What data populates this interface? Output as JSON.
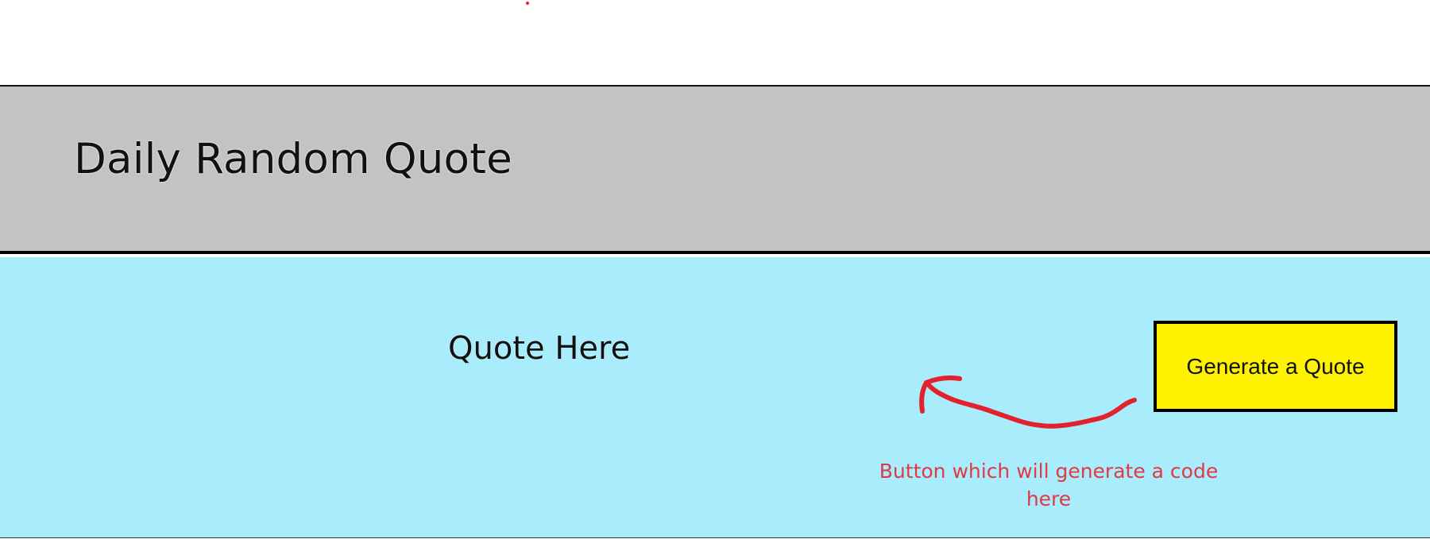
{
  "header": {
    "title": "Daily Random Quote"
  },
  "main": {
    "quote_placeholder": "Quote Here",
    "generate_button_label": "Generate a Quote",
    "annotation_text": "Button which will generate a code here"
  },
  "colors": {
    "header_background": "#c3c3c3",
    "content_background": "#a9ecfc",
    "button_background": "#fff200",
    "annotation_color": "#e03a44"
  },
  "icons": {
    "annotation_arrow": "curved-arrow-icon"
  }
}
